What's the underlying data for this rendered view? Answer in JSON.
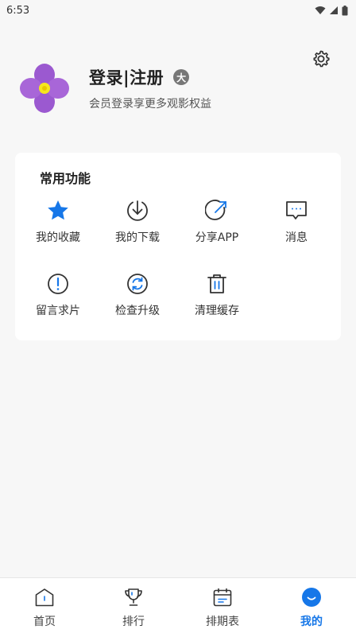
{
  "status_bar": {
    "time": "6:53"
  },
  "profile": {
    "title": "登录|注册",
    "badge": "大",
    "subtitle": "会员登录享更多观影权益"
  },
  "functions": {
    "title": "常用功能",
    "items": [
      {
        "label": "我的收藏",
        "icon": "star-icon"
      },
      {
        "label": "我的下载",
        "icon": "download-icon"
      },
      {
        "label": "分享APP",
        "icon": "share-icon"
      },
      {
        "label": "消息",
        "icon": "message-icon"
      },
      {
        "label": "留言求片",
        "icon": "exclamation-icon"
      },
      {
        "label": "检查升级",
        "icon": "refresh-icon"
      },
      {
        "label": "清理缓存",
        "icon": "trash-icon"
      }
    ]
  },
  "tabbar": {
    "items": [
      {
        "label": "首页",
        "icon": "home-icon",
        "active": false
      },
      {
        "label": "排行",
        "icon": "trophy-icon",
        "active": false
      },
      {
        "label": "排期表",
        "icon": "calendar-icon",
        "active": false
      },
      {
        "label": "我的",
        "icon": "profile-icon",
        "active": true
      }
    ]
  },
  "colors": {
    "accent": "#1677e8",
    "avatar_petal": "#9b59d0",
    "avatar_center": "#f5e61e"
  }
}
